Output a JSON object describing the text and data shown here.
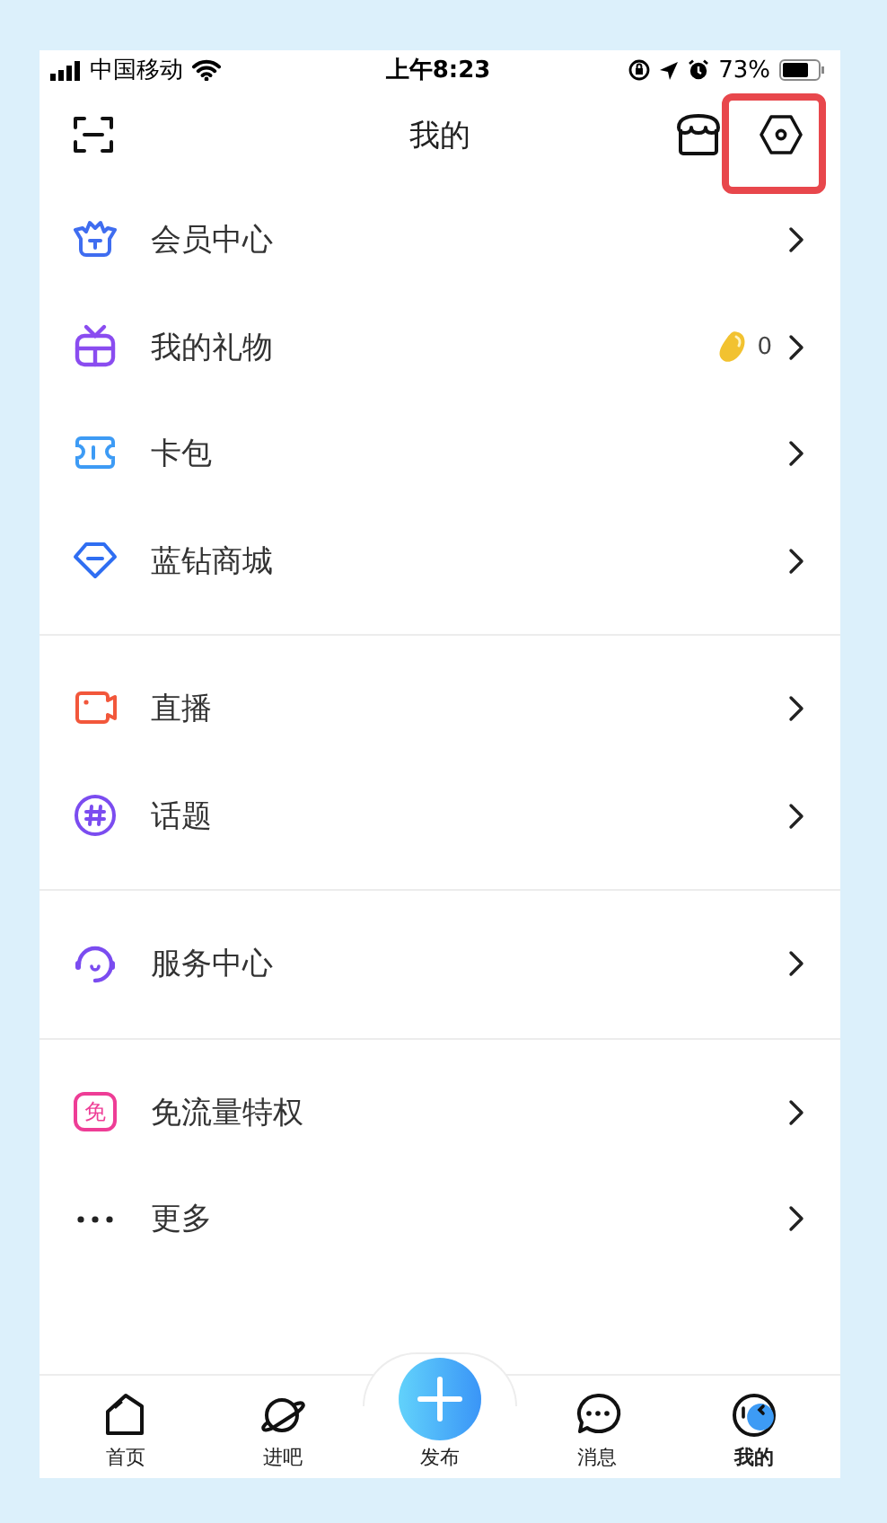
{
  "status_bar": {
    "carrier": "中国移动",
    "time": "上午8:23",
    "battery": "73%"
  },
  "header": {
    "title": "我的"
  },
  "sections": [
    {
      "items": [
        {
          "kind": "crown",
          "label": "会员中心"
        },
        {
          "kind": "gift",
          "label": "我的礼物",
          "badge": "0"
        },
        {
          "kind": "ticket",
          "label": "卡包"
        },
        {
          "kind": "diamond",
          "label": "蓝钻商城"
        }
      ]
    },
    {
      "items": [
        {
          "kind": "camera",
          "label": "直播"
        },
        {
          "kind": "hashtag",
          "label": "话题"
        }
      ]
    },
    {
      "items": [
        {
          "kind": "headset",
          "label": "服务中心"
        }
      ]
    },
    {
      "items": [
        {
          "kind": "free",
          "icon_text": "免",
          "label": "免流量特权"
        },
        {
          "kind": "more",
          "label": "更多"
        }
      ]
    }
  ],
  "tabs": [
    {
      "kind": "home",
      "label": "首页",
      "selected": false
    },
    {
      "kind": "planet",
      "label": "进吧",
      "selected": false
    },
    {
      "kind": "publish",
      "label": "发布",
      "selected": false
    },
    {
      "kind": "message",
      "label": "消息",
      "selected": false
    },
    {
      "kind": "me",
      "label": "我的",
      "selected": true
    }
  ]
}
